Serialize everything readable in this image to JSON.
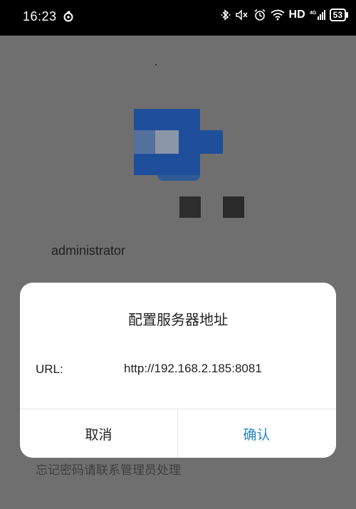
{
  "status_bar": {
    "time": "16:23",
    "hd": "HD",
    "battery": "53",
    "icons": [
      "app-notification-icon",
      "bluetooth-icon",
      "mute-icon",
      "alarm-icon",
      "wifi-icon",
      "signal-4g-icon",
      "battery-icon"
    ]
  },
  "background": {
    "username": "administrator",
    "forgot_password_text": "忘记密码请联系管理员处理",
    "logo_color": "#1f4f9a"
  },
  "dialog": {
    "title": "配置服务器地址",
    "url_label": "URL:",
    "url_value": "http://192.168.2.185:8081",
    "cancel_label": "取消",
    "confirm_label": "确认",
    "confirm_color": "#2a86c7"
  }
}
